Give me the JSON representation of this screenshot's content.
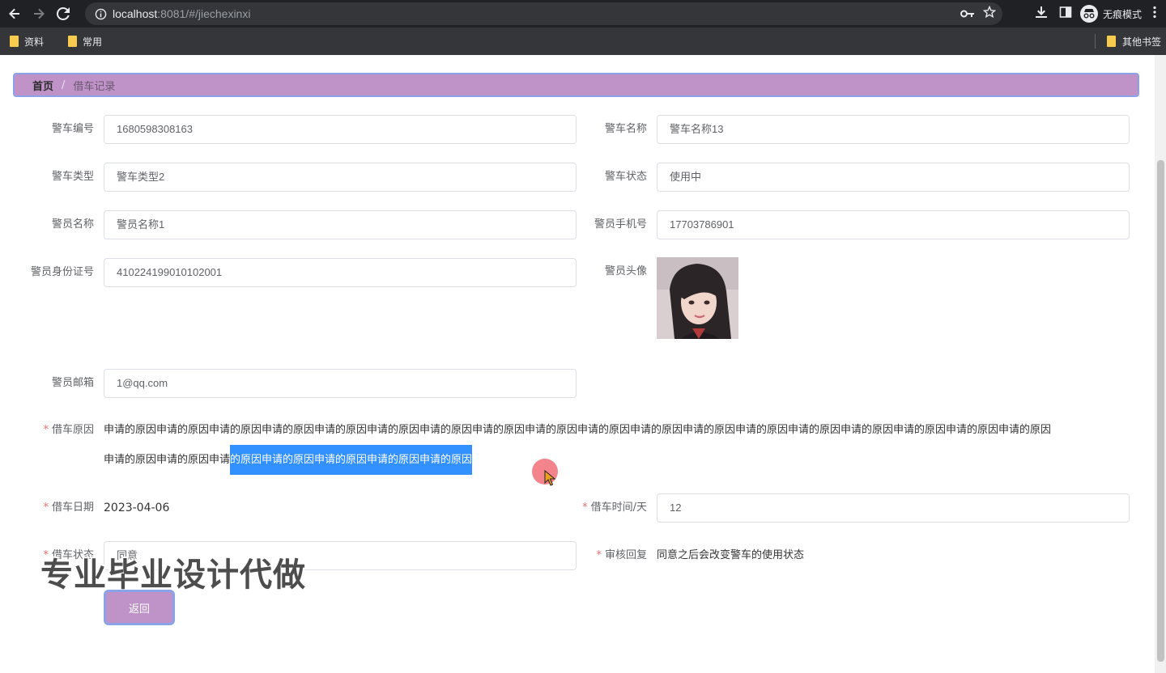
{
  "browser": {
    "url_host": "localhost",
    "url_path": ":8081/#/jiechexinxi",
    "incognito_label": "无痕模式",
    "bookmarks": [
      {
        "label": "资料"
      },
      {
        "label": "常用"
      }
    ],
    "other_bookmarks": "其他书签"
  },
  "breadcrumb": {
    "home": "首页",
    "separator": "/",
    "current": "借车记录"
  },
  "form": {
    "car_no": {
      "label": "警车编号",
      "value": "1680598308163"
    },
    "car_name": {
      "label": "警车名称",
      "value": "警车名称13"
    },
    "car_type": {
      "label": "警车类型",
      "value": "警车类型2"
    },
    "car_status": {
      "label": "警车状态",
      "value": "使用中"
    },
    "officer_name": {
      "label": "警员名称",
      "value": "警员名称1"
    },
    "officer_phone": {
      "label": "警员手机号",
      "value": "17703786901"
    },
    "officer_id": {
      "label": "警员身份证号",
      "value": "410224199010102001"
    },
    "officer_avatar": {
      "label": "警员头像"
    },
    "officer_email": {
      "label": "警员邮箱",
      "value": "1@qq.com"
    },
    "borrow_reason": {
      "label": "借车原因",
      "line1": "申请的原因申请的原因申请的原因申请的原因申请的原因申请的原因申请的原因申请的原因申请的原因申请的原因申请的原因申请的原因申请的原因申请的原因申请的原因申请的原因申请的原因申请的原因",
      "line2_plain": "申请的原因申请的原因申请",
      "line2_selected": "的原因申请的原因申请的原因申请的原因申请的原因"
    },
    "borrow_date": {
      "label": "借车日期",
      "value": "2023-04-06"
    },
    "borrow_days": {
      "label": "借车时间/天",
      "value": "12"
    },
    "borrow_status": {
      "label": "借车状态",
      "value": "同意"
    },
    "review_reply": {
      "label": "审核回复",
      "value": "同意之后会改变警车的使用状态"
    },
    "required_mark": "*"
  },
  "watermark": "专业毕业设计代做",
  "back_button": "返回",
  "colors": {
    "accent": "#c093c8",
    "accent_border": "#8aa3e8",
    "selection": "#3391ff",
    "required": "#f56c6c"
  }
}
